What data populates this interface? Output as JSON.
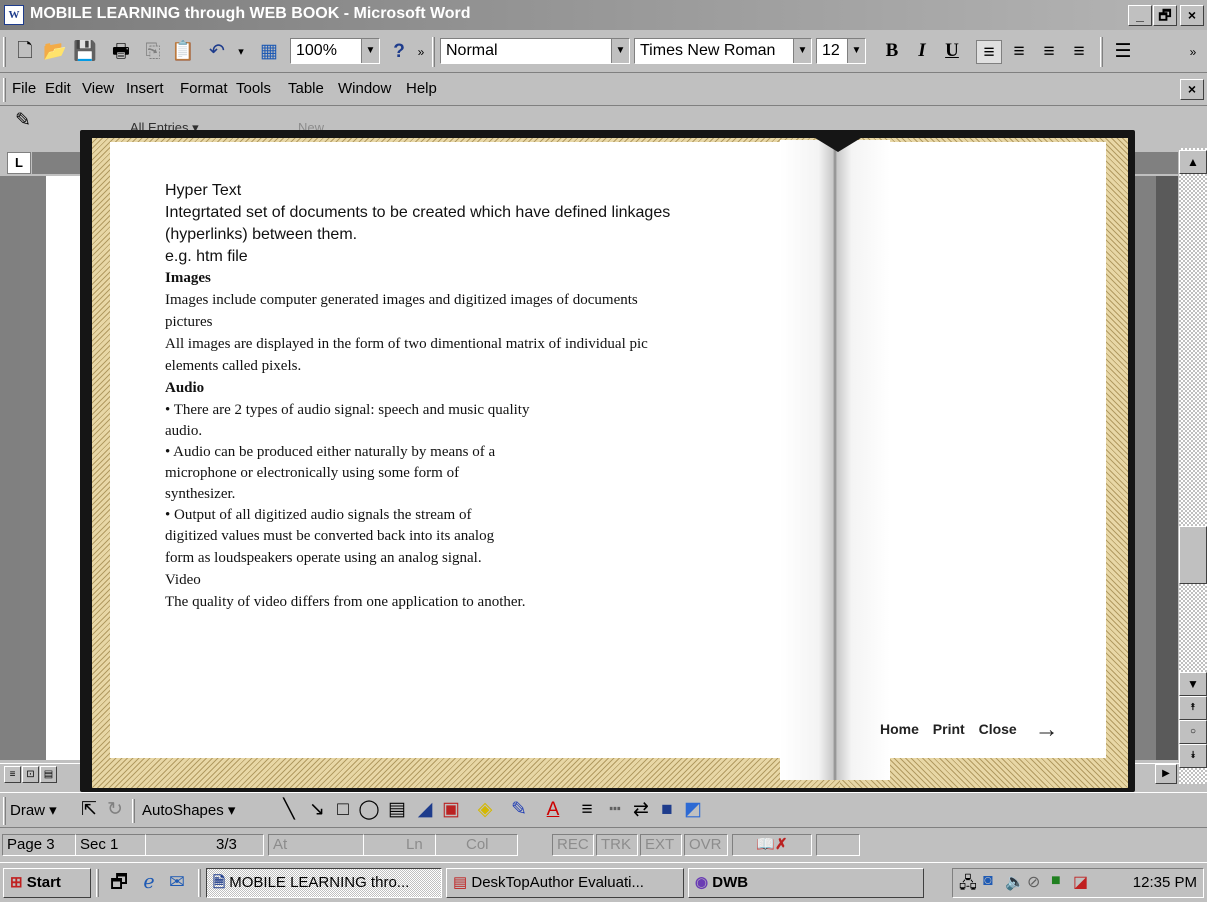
{
  "window": {
    "title": "MOBILE LEARNING through WEB BOOK - Microsoft Word",
    "app_icon": "W",
    "controls": [
      "_",
      "🗗",
      "×"
    ]
  },
  "toolbar": {
    "icons": [
      "new-document-icon",
      "open-icon",
      "save-icon",
      "print-icon",
      "copy-icon",
      "paste-icon",
      "undo-icon",
      "tables-icon",
      "help-icon"
    ],
    "zoom": "100%",
    "style": "Normal",
    "font": "Times New Roman",
    "font_size": "12",
    "bold": "B",
    "italic": "I",
    "underline": "U"
  },
  "menu": {
    "items": [
      "File",
      "Edit",
      "View",
      "Insert",
      "Format",
      "Tools",
      "Table",
      "Window",
      "Help"
    ],
    "close": "×"
  },
  "reviewing": {
    "entries_label": "All Entries ▾",
    "new_label": "New..."
  },
  "ruler": {
    "corner": "L"
  },
  "book": {
    "left_page": [
      {
        "text": "Hyper Text",
        "style": "sans"
      },
      {
        "text": "Integrtated set of documents to be created which have defined linkages",
        "style": "sans"
      },
      {
        "text": "(hyperlinks) between them.",
        "style": "sans"
      },
      {
        "text": "e.g. htm file",
        "style": "sans"
      },
      {
        "text": "Images",
        "style": "serif-bold"
      },
      {
        "text": "Images include computer generated images and digitized images of documents",
        "style": "serif"
      },
      {
        "text": "pictures",
        "style": "serif"
      },
      {
        "text": "All images are displayed in the form of two dimentional matrix of individual pic",
        "style": "serif"
      },
      {
        "text": "elements called pixels.",
        "style": "serif"
      },
      {
        "text": "Audio",
        "style": "serif-bold"
      },
      {
        "text": "• There are 2 types of audio signal: speech and music quality",
        "style": "serif"
      },
      {
        "text": "audio.",
        "style": "serif"
      },
      {
        "text": "• Audio can be produced either naturally by means of a",
        "style": "serif"
      },
      {
        "text": "microphone or electronically using some form of",
        "style": "serif"
      },
      {
        "text": "synthesizer.",
        "style": "serif"
      },
      {
        "text": "• Output of all digitized audio signals the stream of",
        "style": "serif"
      },
      {
        "text": "digitized values must be converted back into its analog",
        "style": "serif"
      },
      {
        "text": "form as loudspeakers operate using an analog signal.",
        "style": "serif"
      },
      {
        "text": "Video",
        "style": "serif"
      },
      {
        "text": "The quality of video differs from one application to another.",
        "style": "serif"
      }
    ],
    "nav": {
      "home": "Home",
      "print": "Print",
      "close": "Close",
      "next_arrow": "→"
    }
  },
  "drawing_toolbar": {
    "draw": "Draw ▾",
    "autoshapes": "AutoShapes ▾"
  },
  "status": {
    "page": "Page 3",
    "sec": "Sec 1",
    "pages": "3/3",
    "at": "At",
    "ln": "Ln",
    "col": "Col",
    "rec": "REC",
    "trk": "TRK",
    "ext": "EXT",
    "ovr": "OVR"
  },
  "taskbar": {
    "start": "Start",
    "tasks": [
      "MOBILE LEARNING thro...",
      "DeskTopAuthor Evaluati...",
      "DWB"
    ],
    "clock": "12:35 PM"
  },
  "colors": {
    "chrome": "#c0c0c0",
    "title_bar": "#808080",
    "book_cover": "#151515",
    "page_edges": "#e8d7a6"
  }
}
